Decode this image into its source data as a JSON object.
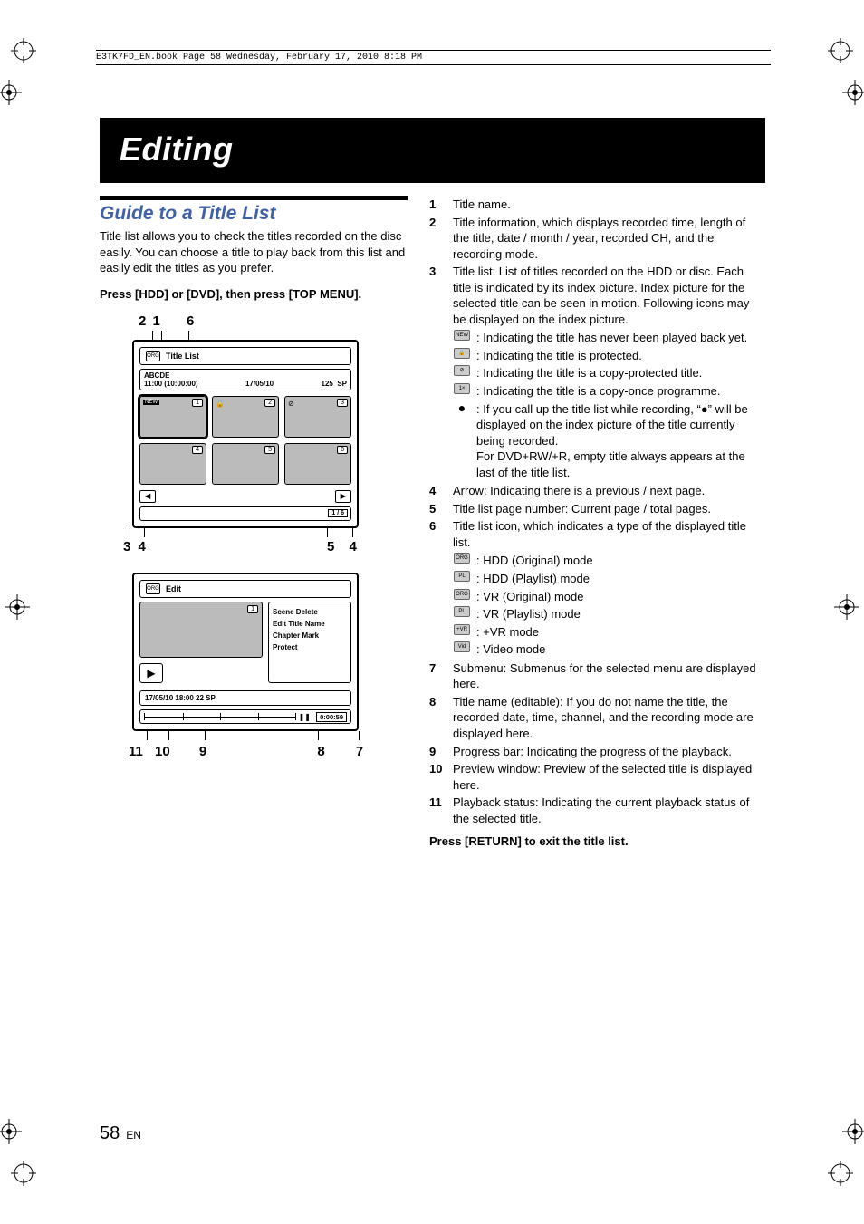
{
  "header_line": "E3TK7FD_EN.book  Page 58  Wednesday, February 17, 2010  8:18 PM",
  "banner": "Editing",
  "section_title": "Guide to a Title List",
  "intro": "Title list allows you to check the titles recorded on the disc easily. You can choose a title to play back from this list and easily edit the titles as you prefer.",
  "instruction": "Press [HDD] or [DVD], then press [TOP MENU].",
  "diagram1": {
    "top_callouts": {
      "a": "2",
      "b": "1",
      "c": "6"
    },
    "bot_callouts": {
      "a": "3",
      "b": "4",
      "c": "5",
      "d": "4"
    },
    "screen_title_icon": "ORG",
    "screen_title": "Title List",
    "info_name": "ABCDE",
    "info_time": "11:00 (10:00:00)",
    "info_date": "17/05/10",
    "info_ch": "125",
    "info_mode": "SP",
    "thumbs": [
      "1",
      "2",
      "3",
      "4",
      "5",
      "6"
    ],
    "new_label": "NEW",
    "arrow_left": "◄",
    "arrow_right": "►",
    "page_indicator": "1 / 6"
  },
  "diagram2": {
    "screen_title_icon": "ORG",
    "screen_title": "Edit",
    "thumb_num": "1",
    "submenu": [
      "Scene Delete",
      "Edit Title Name",
      "Chapter Mark",
      "Protect"
    ],
    "info2": "17/05/10 18:00 22 SP",
    "time": "0:00:59",
    "play_glyph": "▶",
    "pause_glyph": "❚❚",
    "bot_callouts": {
      "a": "11",
      "b": "10",
      "c": "9",
      "d": "8",
      "e": "7"
    }
  },
  "items": [
    {
      "n": "1",
      "t": "Title name."
    },
    {
      "n": "2",
      "t": "Title information, which displays recorded time, length of the title, date / month / year, recorded CH, and the recording mode."
    },
    {
      "n": "3",
      "t": "Title list: List of titles recorded on the HDD or disc. Each title is indicated by its index picture. Index picture for the selected title can be seen in motion. Following icons may be displayed on the index picture."
    },
    {
      "n": "4",
      "t": "Arrow: Indicating there is a previous / next page."
    },
    {
      "n": "5",
      "t": "Title list page number: Current page / total pages."
    },
    {
      "n": "6",
      "t": "Title list icon, which indicates a type of the displayed title list."
    },
    {
      "n": "7",
      "t": "Submenu: Submenus for the selected menu are displayed here."
    },
    {
      "n": "8",
      "t": "Title name (editable): If you do not name the title, the recorded date, time, channel, and the recording mode are displayed here."
    },
    {
      "n": "9",
      "t": "Progress bar: Indicating the progress of the playback."
    },
    {
      "n": "10",
      "t": "Preview window: Preview of the selected title is displayed here."
    },
    {
      "n": "11",
      "t": "Playback status: Indicating the current playback status of the selected title."
    }
  ],
  "item3_sub": [
    {
      "ic": "NEW",
      "t": ": Indicating the title has never been played back yet."
    },
    {
      "ic": "🔒",
      "t": ": Indicating the title is protected."
    },
    {
      "ic": "⊘",
      "t": ": Indicating the title is a copy-protected title."
    },
    {
      "ic": "1×",
      "t": ": Indicating the title is a copy-once programme."
    },
    {
      "ic": "●",
      "bullet": true,
      "t": ": If you call up the title list while recording, “●” will be displayed on the index picture of the title currently being recorded.",
      "note": "For DVD+RW/+R, empty title always appears at the last of the title list."
    }
  ],
  "item6_sub": [
    {
      "ic": "ORG",
      "t": ": HDD (Original) mode"
    },
    {
      "ic": "PL",
      "t": ": HDD (Playlist) mode"
    },
    {
      "ic": "ORG",
      "t": ": VR (Original) mode"
    },
    {
      "ic": "PL",
      "t": ": VR (Playlist) mode"
    },
    {
      "ic": "+VR",
      "t": ": +VR mode"
    },
    {
      "ic": "Vid",
      "t": ": Video mode"
    }
  ],
  "exit_line": "Press [RETURN] to exit the title list.",
  "page_number": "58",
  "page_lang": "EN"
}
